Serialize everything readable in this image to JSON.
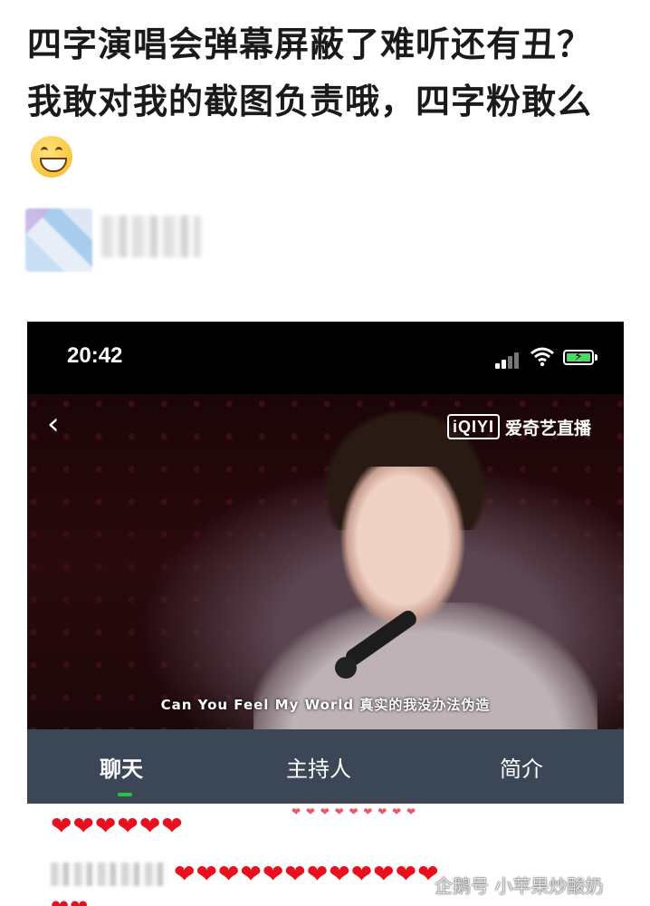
{
  "post": {
    "text": "四字演唱会弹幕屏蔽了难听还有丑？我敢对我的截图负责哦，四字粉敢么",
    "emoji": "grinning-face-emoji"
  },
  "screenshot": {
    "status_bar": {
      "time": "20:42"
    },
    "video": {
      "back_icon": "‹",
      "watermark_logo": "iQIYI",
      "watermark_text": "爱奇艺直播",
      "subtitle": "Can You Feel My World 真实的我没办法伪造"
    },
    "tabs": [
      {
        "label": "聊天",
        "active": true
      },
      {
        "label": "主持人",
        "active": false
      },
      {
        "label": "简介",
        "active": false
      }
    ],
    "chat": {
      "row1": "❤❤❤❤❤❤",
      "row2": "❤❤❤❤❤❤❤❤❤❤❤❤"
    }
  },
  "credit": {
    "text": "企鹅号 小苹果炒酸奶"
  },
  "colors": {
    "heart": "#e8101e",
    "tab_bar": "#3b4656",
    "active_underline": "#27c24c",
    "battery": "#4cd964"
  }
}
